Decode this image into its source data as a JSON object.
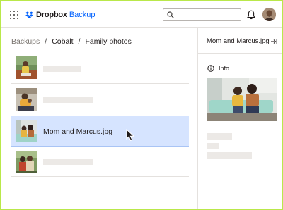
{
  "app": {
    "brand": "Dropbox",
    "product": "Backup",
    "colors": {
      "accent": "#0061fe",
      "selection": "#d6e4ff",
      "frame": "#b9e84a"
    }
  },
  "header": {
    "apps_icon": "grid-icon",
    "search": {
      "placeholder": "",
      "value": ""
    },
    "notifications_icon": "bell-icon"
  },
  "breadcrumb": {
    "items": [
      "Backups",
      "Cobalt",
      "Family photos"
    ],
    "separator": "/"
  },
  "files": [
    {
      "name": "",
      "thumbnail": "photo-woman-reading"
    },
    {
      "name": "",
      "thumbnail": "photo-person-with-baby"
    },
    {
      "name": "Mom and Marcus.jpg",
      "thumbnail": "photo-mom-and-marcus",
      "selected": true
    },
    {
      "name": "",
      "thumbnail": "photo-two-people"
    }
  ],
  "panel": {
    "title": "Mom and Marcus.jpg",
    "collapse_icon": "collapse-right-icon",
    "info_label": "Info"
  }
}
